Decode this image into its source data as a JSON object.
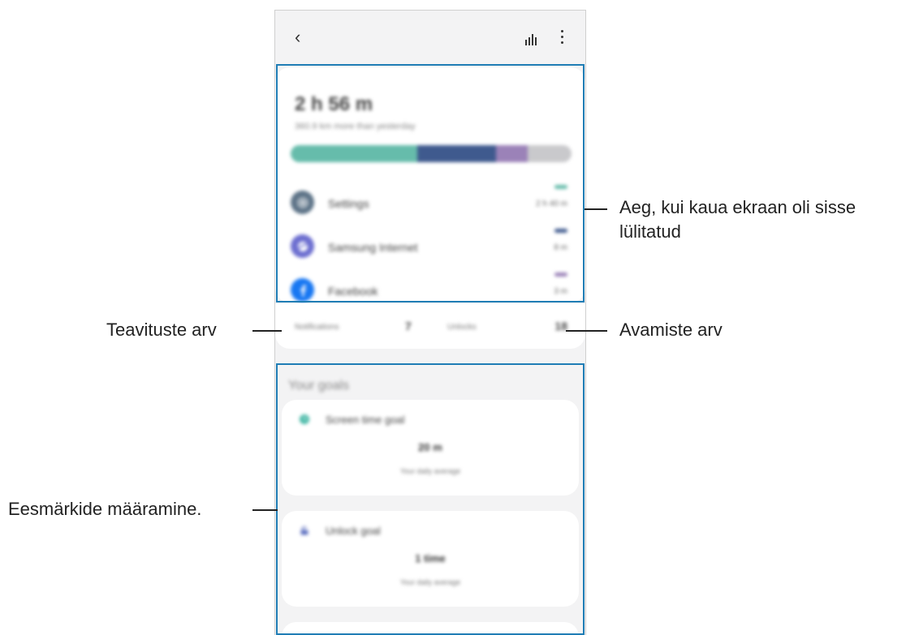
{
  "toolbar": {
    "back_glyph": "‹"
  },
  "usage": {
    "total_time": "2 h 56 m",
    "subtitle": "360.9 km more than yesterday",
    "bar_colors": [
      "#66bcab",
      "#3f5a8e",
      "#9b82b8",
      "#c9c9cc"
    ],
    "bar_shares": [
      0.45,
      0.28,
      0.115,
      0.155
    ]
  },
  "apps": [
    {
      "name": "Settings",
      "time": "2 h 40 m",
      "color": "#5e7488",
      "dash": "#66bcab"
    },
    {
      "name": "Samsung Internet",
      "time": "8 m",
      "color": "#6d6fd0",
      "dash": "#3f5a8e"
    },
    {
      "name": "Facebook",
      "time": "3 m",
      "color": "#1877f2",
      "dash": "#9b82b8"
    }
  ],
  "stats": {
    "notifications_label": "Notifications",
    "notifications_value": "7",
    "unlocks_label": "Unlocks",
    "unlocks_value": "18"
  },
  "goals": {
    "title": "Your goals",
    "screen_time": {
      "title": "Screen time goal",
      "value": "20 m",
      "subtitle": "Your daily average"
    },
    "unlock": {
      "title": "Unlock goal",
      "value": "1 time",
      "subtitle": "Your daily average"
    }
  },
  "callouts": {
    "screen_time": "Aeg, kui kaua ekraan oli sisse",
    "screen_time_line2": "lülitatud",
    "notifications": "Teavituste arv",
    "unlocks": "Avamiste arv",
    "goals": "Eesmärkide määramine."
  },
  "colors": {
    "highlight": "#1f7db5",
    "accent_teal": "#44b8a6"
  }
}
